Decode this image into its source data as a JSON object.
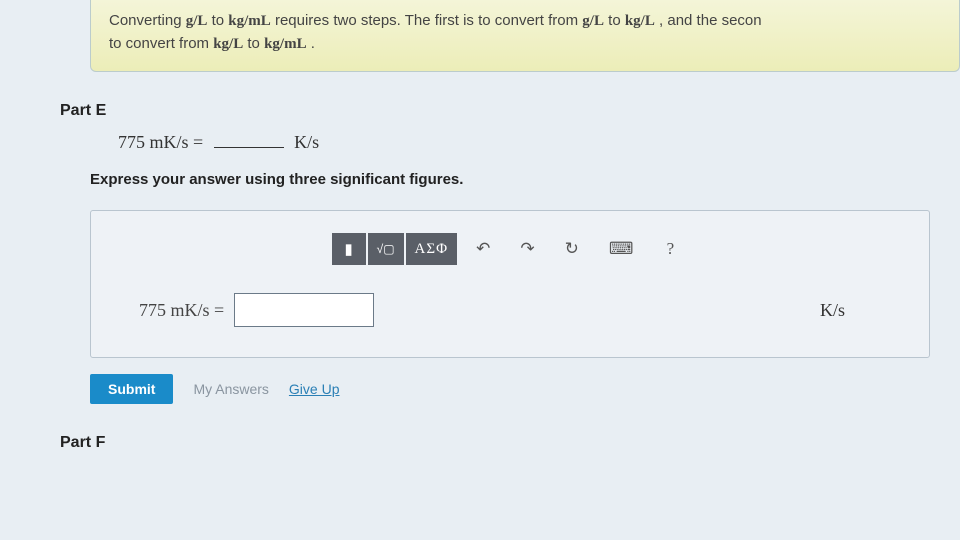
{
  "hint": {
    "line1_a": "Converting ",
    "line1_b": " to ",
    "line1_c": " requires two steps. The first is to convert from ",
    "line1_d": " to ",
    "line1_e": ", and the secon",
    "line2_a": "to convert from ",
    "line2_b": " to ",
    "line2_c": ".",
    "unit_gL": "g/L",
    "unit_kgmL": "kg/mL",
    "unit_kgL": "kg/L"
  },
  "partE": {
    "label": "Part E",
    "eq_left": "775 mK/s =",
    "eq_right": "K/s",
    "instruction": "Express your answer using three significant figures.",
    "input_left": "775 mK/s =",
    "input_value": "",
    "input_right": "K/s",
    "submit": "Submit",
    "my_answers": "My Answers",
    "give_up": "Give Up"
  },
  "toolbar": {
    "templates_sym": "▮",
    "fraction_sym": "√▢",
    "greek": "ΑΣΦ",
    "undo": "↶",
    "redo": "↷",
    "reset": "↻",
    "keyboard": "⌨",
    "help": "?"
  },
  "partF": {
    "label": "Part F"
  }
}
